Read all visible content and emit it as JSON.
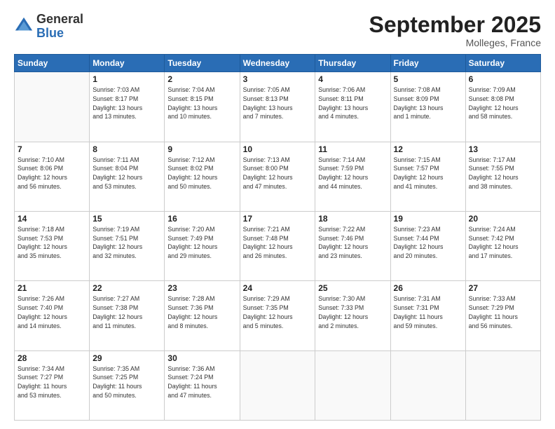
{
  "logo": {
    "general": "General",
    "blue": "Blue"
  },
  "title": {
    "month_year": "September 2025",
    "location": "Molleges, France"
  },
  "weekdays": [
    "Sunday",
    "Monday",
    "Tuesday",
    "Wednesday",
    "Thursday",
    "Friday",
    "Saturday"
  ],
  "weeks": [
    [
      {
        "day": "",
        "info": ""
      },
      {
        "day": "1",
        "info": "Sunrise: 7:03 AM\nSunset: 8:17 PM\nDaylight: 13 hours\nand 13 minutes."
      },
      {
        "day": "2",
        "info": "Sunrise: 7:04 AM\nSunset: 8:15 PM\nDaylight: 13 hours\nand 10 minutes."
      },
      {
        "day": "3",
        "info": "Sunrise: 7:05 AM\nSunset: 8:13 PM\nDaylight: 13 hours\nand 7 minutes."
      },
      {
        "day": "4",
        "info": "Sunrise: 7:06 AM\nSunset: 8:11 PM\nDaylight: 13 hours\nand 4 minutes."
      },
      {
        "day": "5",
        "info": "Sunrise: 7:08 AM\nSunset: 8:09 PM\nDaylight: 13 hours\nand 1 minute."
      },
      {
        "day": "6",
        "info": "Sunrise: 7:09 AM\nSunset: 8:08 PM\nDaylight: 12 hours\nand 58 minutes."
      }
    ],
    [
      {
        "day": "7",
        "info": "Sunrise: 7:10 AM\nSunset: 8:06 PM\nDaylight: 12 hours\nand 56 minutes."
      },
      {
        "day": "8",
        "info": "Sunrise: 7:11 AM\nSunset: 8:04 PM\nDaylight: 12 hours\nand 53 minutes."
      },
      {
        "day": "9",
        "info": "Sunrise: 7:12 AM\nSunset: 8:02 PM\nDaylight: 12 hours\nand 50 minutes."
      },
      {
        "day": "10",
        "info": "Sunrise: 7:13 AM\nSunset: 8:00 PM\nDaylight: 12 hours\nand 47 minutes."
      },
      {
        "day": "11",
        "info": "Sunrise: 7:14 AM\nSunset: 7:59 PM\nDaylight: 12 hours\nand 44 minutes."
      },
      {
        "day": "12",
        "info": "Sunrise: 7:15 AM\nSunset: 7:57 PM\nDaylight: 12 hours\nand 41 minutes."
      },
      {
        "day": "13",
        "info": "Sunrise: 7:17 AM\nSunset: 7:55 PM\nDaylight: 12 hours\nand 38 minutes."
      }
    ],
    [
      {
        "day": "14",
        "info": "Sunrise: 7:18 AM\nSunset: 7:53 PM\nDaylight: 12 hours\nand 35 minutes."
      },
      {
        "day": "15",
        "info": "Sunrise: 7:19 AM\nSunset: 7:51 PM\nDaylight: 12 hours\nand 32 minutes."
      },
      {
        "day": "16",
        "info": "Sunrise: 7:20 AM\nSunset: 7:49 PM\nDaylight: 12 hours\nand 29 minutes."
      },
      {
        "day": "17",
        "info": "Sunrise: 7:21 AM\nSunset: 7:48 PM\nDaylight: 12 hours\nand 26 minutes."
      },
      {
        "day": "18",
        "info": "Sunrise: 7:22 AM\nSunset: 7:46 PM\nDaylight: 12 hours\nand 23 minutes."
      },
      {
        "day": "19",
        "info": "Sunrise: 7:23 AM\nSunset: 7:44 PM\nDaylight: 12 hours\nand 20 minutes."
      },
      {
        "day": "20",
        "info": "Sunrise: 7:24 AM\nSunset: 7:42 PM\nDaylight: 12 hours\nand 17 minutes."
      }
    ],
    [
      {
        "day": "21",
        "info": "Sunrise: 7:26 AM\nSunset: 7:40 PM\nDaylight: 12 hours\nand 14 minutes."
      },
      {
        "day": "22",
        "info": "Sunrise: 7:27 AM\nSunset: 7:38 PM\nDaylight: 12 hours\nand 11 minutes."
      },
      {
        "day": "23",
        "info": "Sunrise: 7:28 AM\nSunset: 7:36 PM\nDaylight: 12 hours\nand 8 minutes."
      },
      {
        "day": "24",
        "info": "Sunrise: 7:29 AM\nSunset: 7:35 PM\nDaylight: 12 hours\nand 5 minutes."
      },
      {
        "day": "25",
        "info": "Sunrise: 7:30 AM\nSunset: 7:33 PM\nDaylight: 12 hours\nand 2 minutes."
      },
      {
        "day": "26",
        "info": "Sunrise: 7:31 AM\nSunset: 7:31 PM\nDaylight: 11 hours\nand 59 minutes."
      },
      {
        "day": "27",
        "info": "Sunrise: 7:33 AM\nSunset: 7:29 PM\nDaylight: 11 hours\nand 56 minutes."
      }
    ],
    [
      {
        "day": "28",
        "info": "Sunrise: 7:34 AM\nSunset: 7:27 PM\nDaylight: 11 hours\nand 53 minutes."
      },
      {
        "day": "29",
        "info": "Sunrise: 7:35 AM\nSunset: 7:25 PM\nDaylight: 11 hours\nand 50 minutes."
      },
      {
        "day": "30",
        "info": "Sunrise: 7:36 AM\nSunset: 7:24 PM\nDaylight: 11 hours\nand 47 minutes."
      },
      {
        "day": "",
        "info": ""
      },
      {
        "day": "",
        "info": ""
      },
      {
        "day": "",
        "info": ""
      },
      {
        "day": "",
        "info": ""
      }
    ]
  ]
}
